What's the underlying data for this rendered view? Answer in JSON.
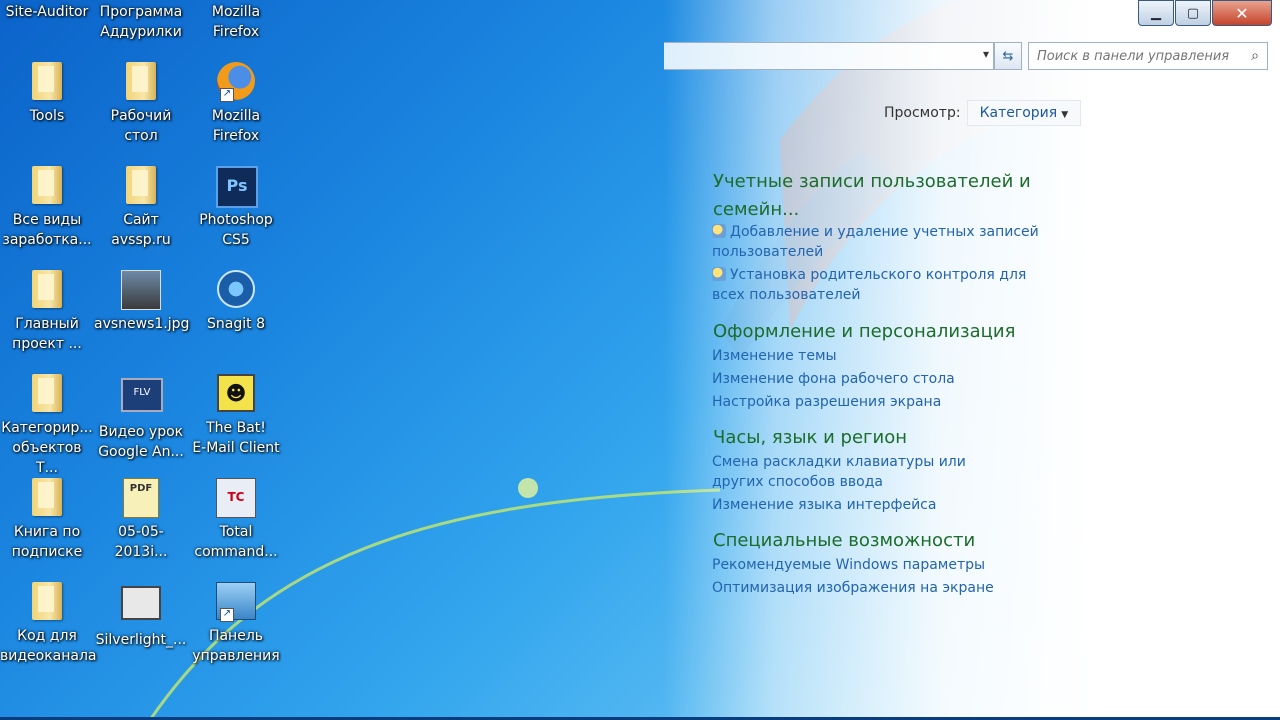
{
  "desktop": {
    "icons": [
      {
        "label": "Site-Auditor",
        "type": "text-only"
      },
      {
        "label": "Программа\nАддурилки",
        "type": "text-only"
      },
      {
        "label": "Mozilla\nFirefox",
        "type": "text-only"
      },
      {
        "label": "Tools",
        "type": "folder"
      },
      {
        "label": "Рабочий\nстол",
        "type": "folder"
      },
      {
        "label": "Mozilla\nFirefox",
        "type": "firefox"
      },
      {
        "label": "Все виды\nзаработка...",
        "type": "folder"
      },
      {
        "label": "Сайт avssp.ru",
        "type": "folder"
      },
      {
        "label": "Photoshop\nCS5",
        "type": "photoshop"
      },
      {
        "label": "Главный\nпроект ...",
        "type": "folder"
      },
      {
        "label": "avsnews1.jpg",
        "type": "photo"
      },
      {
        "label": "Snagit 8",
        "type": "snagit"
      },
      {
        "label": "Категорир...\nобъектов Т...",
        "type": "folder"
      },
      {
        "label": "Видео урок\nGoogle An...",
        "type": "flv"
      },
      {
        "label": "The Bat!\nE-Mail Client",
        "type": "thebat"
      },
      {
        "label": "Книга по\nподписке",
        "type": "folder"
      },
      {
        "label": "05-05-2013i...",
        "type": "pdf"
      },
      {
        "label": "Total\ncommand...",
        "type": "totalcmd"
      },
      {
        "label": "Код для\nвидеоканала",
        "type": "folder"
      },
      {
        "label": "Silverlight_...",
        "type": "silverlight"
      },
      {
        "label": "Панель\nуправления",
        "type": "controlpanel"
      }
    ],
    "icon_glyphs": {
      "flv": "FLV",
      "pdf": "PDF",
      "ps": "Ps",
      "bat": "☻",
      "tc": "TC"
    }
  },
  "window": {
    "buttons": {
      "minimize": "▁",
      "maximize": "▢",
      "close": "✕"
    },
    "address_arrow": "▾",
    "refresh_glyph": "⇆",
    "search": {
      "placeholder": "Поиск в панели управления",
      "icon": "search-icon"
    },
    "view": {
      "label": "Просмотр:",
      "value": "Категория"
    },
    "categories": [
      {
        "title": "Учетные записи пользователей и семейн...",
        "links": [
          "Добавление и удаление учетных записей пользователей",
          "Установка родительского контроля для всех пользователей"
        ]
      },
      {
        "title": "Оформление и персонализация",
        "links": [
          "Изменение темы",
          "Изменение фона рабочего стола",
          "Настройка разрешения экрана"
        ]
      },
      {
        "title": "Часы, язык и регион",
        "links": [
          "Смена раскладки клавиатуры или других способов ввода",
          "Изменение языка интерфейса"
        ]
      },
      {
        "title": "Специальные возможности",
        "links": [
          "Рекомендуемые Windows параметры",
          "Оптимизация изображения на экране"
        ]
      }
    ]
  },
  "colors": {
    "category_title": "#1c6c2b",
    "link": "#2264b0"
  }
}
